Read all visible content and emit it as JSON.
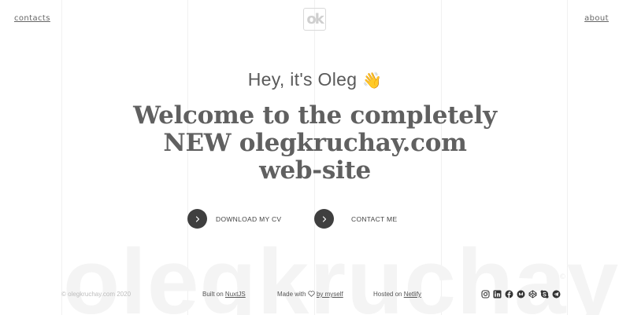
{
  "nav": {
    "contacts_label": "contacts",
    "about_label": "about"
  },
  "logo": {
    "text": "ok"
  },
  "hero": {
    "greeting": "Hey, it's Oleg",
    "wave_emoji": "👋",
    "headline_line1": "Welcome to the completely",
    "headline_line2": "NEW olegkruchay.com",
    "headline_line3": "web-site"
  },
  "actions": {
    "download_cv_label": "DOWNLOAD MY CV",
    "contact_me_label": "CONTACT ME"
  },
  "watermark": {
    "text": "olegkruchay",
    "mark": "©"
  },
  "footer": {
    "copyright": "© olegkruchay.com 2020",
    "built_prefix": "Built on",
    "built_link": "NuxtJS",
    "made_prefix": "Made with",
    "made_link": "by myself",
    "hosted_prefix": "Hosted on",
    "hosted_link": "Netlify"
  },
  "socials": [
    "instagram-icon",
    "linkedin-icon",
    "facebook-icon",
    "medium-icon",
    "codepen-icon",
    "skype-icon",
    "telegram-icon"
  ],
  "colors": {
    "text": "#555555",
    "headline": "#606060",
    "button": "#3f3f3f",
    "watermark": "#f4f4f4",
    "wave": "#e0a63a"
  }
}
